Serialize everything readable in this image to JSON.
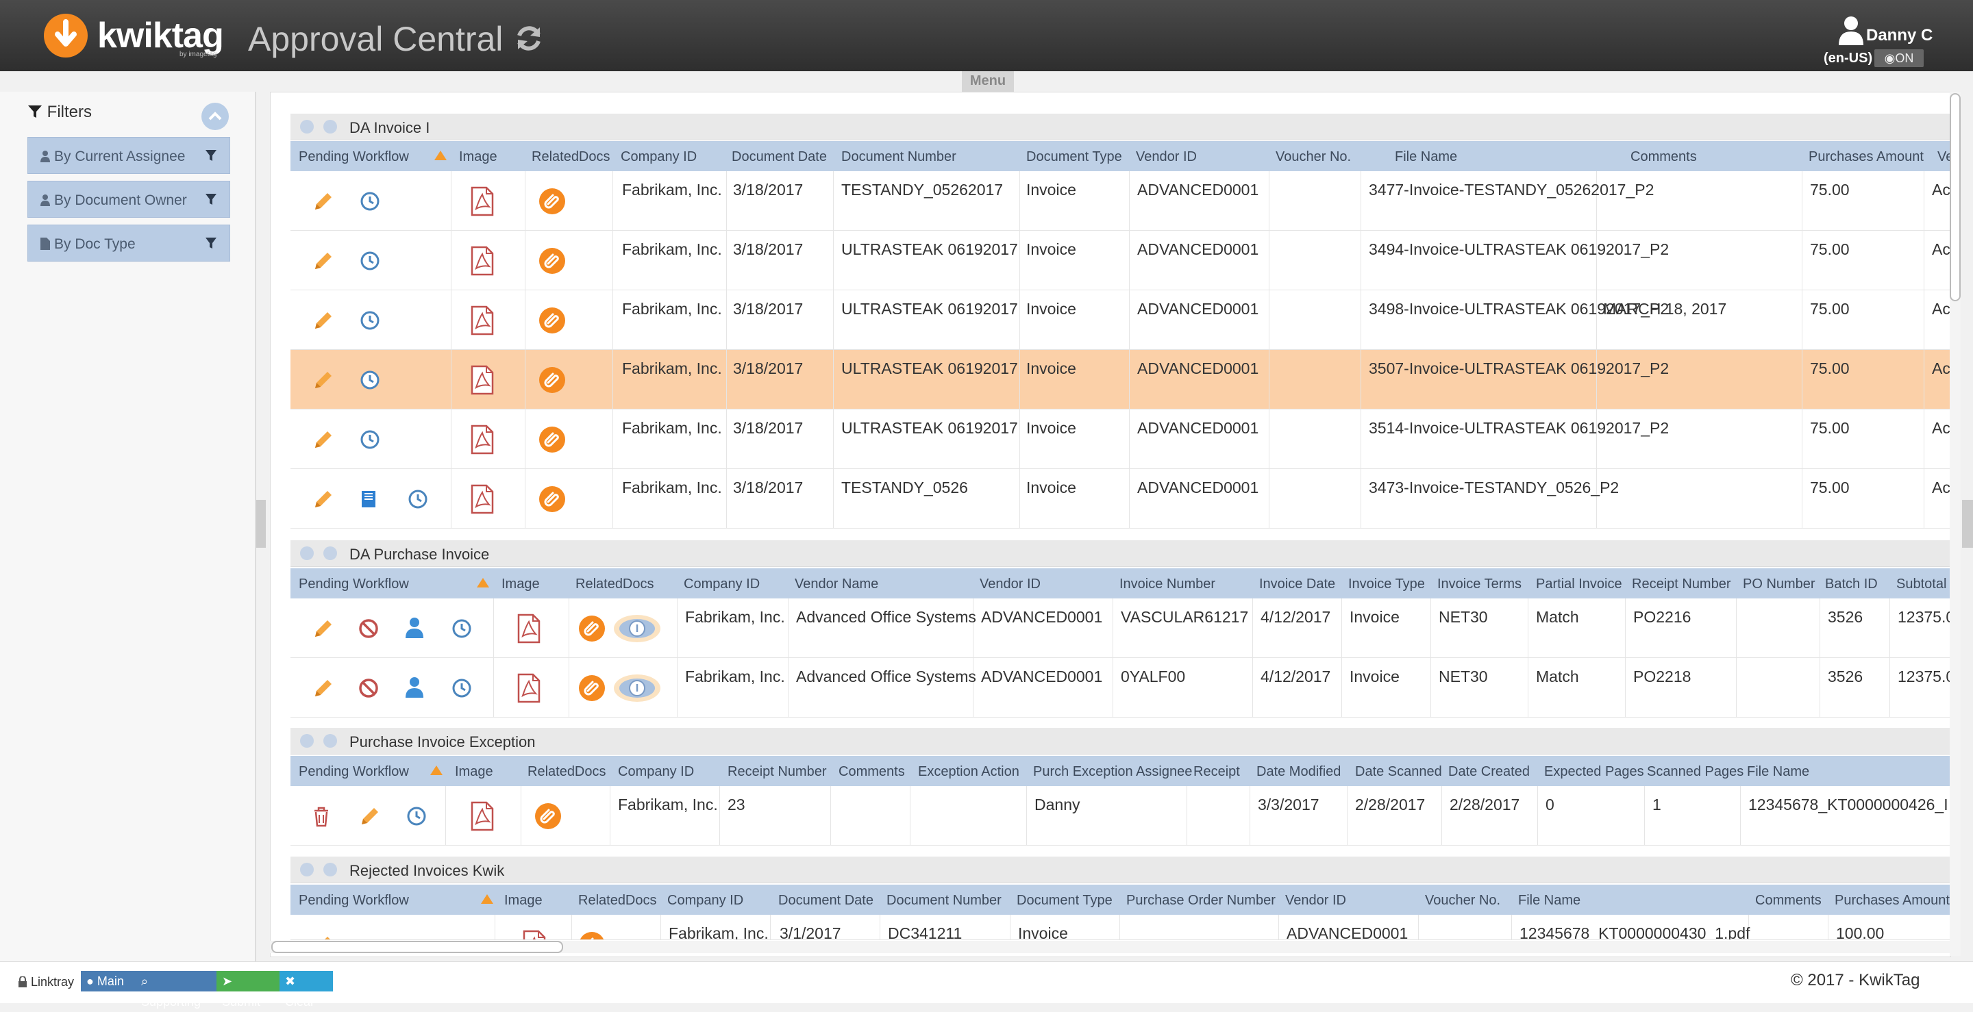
{
  "header": {
    "logo_text": "kwiktag",
    "logo_sub": "by imagetag",
    "app_title": "Approval Central",
    "user_name": "Danny C",
    "locale": "(en-US)",
    "toggle_label": "ON",
    "menu_label": "Menu"
  },
  "sidebar": {
    "title": "Filters",
    "filters": [
      {
        "label": "By Current Assignee"
      },
      {
        "label": "By Document Owner"
      },
      {
        "label": "By Doc Type"
      }
    ]
  },
  "groups": [
    {
      "title": "DA Invoice I",
      "columns": [
        "Pending Workflow",
        "Image",
        "RelatedDocs",
        "Company ID",
        "Document Date",
        "Document Number",
        "Document Type",
        "Vendor ID",
        "Voucher No.",
        "File Name",
        "Comments",
        "Purchases Amount",
        "Ve"
      ],
      "rows": [
        {
          "company": "Fabrikam, Inc.",
          "date": "3/18/2017",
          "docnum": "TESTANDY_05262017",
          "doctype": "Invoice",
          "vendor": "ADVANCED0001",
          "voucher": "",
          "file": "3477-Invoice-TESTANDY_05262017_P2",
          "comments": "",
          "amount": "75.00",
          "extra": "Ac"
        },
        {
          "company": "Fabrikam, Inc.",
          "date": "3/18/2017",
          "docnum": "ULTRASTEAK 06192017",
          "doctype": "Invoice",
          "vendor": "ADVANCED0001",
          "voucher": "",
          "file": "3494-Invoice-ULTRASTEAK 06192017_P2",
          "comments": "",
          "amount": "75.00",
          "extra": "Ac"
        },
        {
          "company": "Fabrikam, Inc.",
          "date": "3/18/2017",
          "docnum": "ULTRASTEAK 06192017",
          "doctype": "Invoice",
          "vendor": "ADVANCED0001",
          "voucher": "",
          "file": "3498-Invoice-ULTRASTEAK 06192017_P2",
          "comments": "MARCH 18, 2017",
          "amount": "75.00",
          "extra": "Ac"
        },
        {
          "company": "Fabrikam, Inc.",
          "date": "3/18/2017",
          "docnum": "ULTRASTEAK 06192017",
          "doctype": "Invoice",
          "vendor": "ADVANCED0001",
          "voucher": "",
          "file": "3507-Invoice-ULTRASTEAK 06192017_P2",
          "comments": "",
          "amount": "75.00",
          "extra": "Ac"
        },
        {
          "company": "Fabrikam, Inc.",
          "date": "3/18/2017",
          "docnum": "ULTRASTEAK 06192017",
          "doctype": "Invoice",
          "vendor": "ADVANCED0001",
          "voucher": "",
          "file": "3514-Invoice-ULTRASTEAK 06192017_P2",
          "comments": "",
          "amount": "75.00",
          "extra": "Ac"
        },
        {
          "company": "Fabrikam, Inc.",
          "date": "3/18/2017",
          "docnum": "TESTANDY_0526",
          "doctype": "Invoice",
          "vendor": "ADVANCED0001",
          "voucher": "",
          "file": "3473-Invoice-TESTANDY_0526_P2",
          "comments": "",
          "amount": "75.00",
          "extra": "Ac"
        }
      ]
    },
    {
      "title": "DA Purchase Invoice",
      "columns": [
        "Pending Workflow",
        "Image",
        "RelatedDocs",
        "Company ID",
        "Vendor Name",
        "Vendor ID",
        "Invoice Number",
        "Invoice Date",
        "Invoice Type",
        "Invoice Terms",
        "Partial Invoice",
        "Receipt Number",
        "PO Number",
        "Batch ID",
        "Subtotal"
      ],
      "rows": [
        {
          "company": "Fabrikam, Inc.",
          "vname": "Advanced Office Systems",
          "vendor": "ADVANCED0001",
          "invnum": "VASCULAR61217",
          "invdate": "4/12/2017",
          "invtype": "Invoice",
          "terms": "NET30",
          "partial": "Match",
          "receipt": "PO2216",
          "po": "",
          "batch": "3526",
          "subtotal": "12375.0"
        },
        {
          "company": "Fabrikam, Inc.",
          "vname": "Advanced Office Systems",
          "vendor": "ADVANCED0001",
          "invnum": "0YALF00",
          "invdate": "4/12/2017",
          "invtype": "Invoice",
          "terms": "NET30",
          "partial": "Match",
          "receipt": "PO2218",
          "po": "",
          "batch": "3526",
          "subtotal": "12375.0"
        }
      ]
    },
    {
      "title": "Purchase Invoice Exception",
      "columns": [
        "Pending Workflow",
        "Image",
        "RelatedDocs",
        "Company ID",
        "Receipt Number",
        "Comments",
        "Exception Action",
        "Purch Exception Assignee",
        "Receipt",
        "Date Modified",
        "Date Scanned",
        "Date Created",
        "Expected Pages",
        "Scanned Pages",
        "File Name"
      ],
      "rows": [
        {
          "company": "Fabrikam, Inc.",
          "receipt": "23",
          "comments": "",
          "action": "",
          "assignee": "Danny",
          "receiptcol": "",
          "modified": "3/3/2017",
          "scanned": "2/28/2017",
          "created": "2/28/2017",
          "expected": "0",
          "scannedpages": "1",
          "file": "12345678_KT0000000426_I"
        }
      ]
    },
    {
      "title": "Rejected Invoices Kwik",
      "columns": [
        "Pending Workflow",
        "Image",
        "RelatedDocs",
        "Company ID",
        "Document Date",
        "Document Number",
        "Document Type",
        "Purchase Order Number",
        "Vendor ID",
        "Voucher No.",
        "File Name",
        "Comments",
        "Purchases Amount"
      ],
      "rows": [
        {
          "company": "Fabrikam, Inc.",
          "date": "3/1/2017",
          "docnum": "DC341211",
          "doctype": "Invoice",
          "ponum": "",
          "vendor": "ADVANCED0001",
          "voucher": "",
          "file": "12345678_KT0000000430_1.pdf",
          "comments": "",
          "amount": "100.00"
        }
      ]
    }
  ],
  "footer": {
    "linktray": "Linktray",
    "main": "Main",
    "supporting": "Supporting",
    "submit": "Submit",
    "clear": "Clear",
    "copyright": "© 2017 - KwikTag"
  },
  "colors": {
    "accent_orange": "#f5891f",
    "header_blue": "#bed0e6",
    "selected_row": "#fbd0a8",
    "icon_blue": "#4a90c8",
    "icon_red": "#c0504d"
  }
}
